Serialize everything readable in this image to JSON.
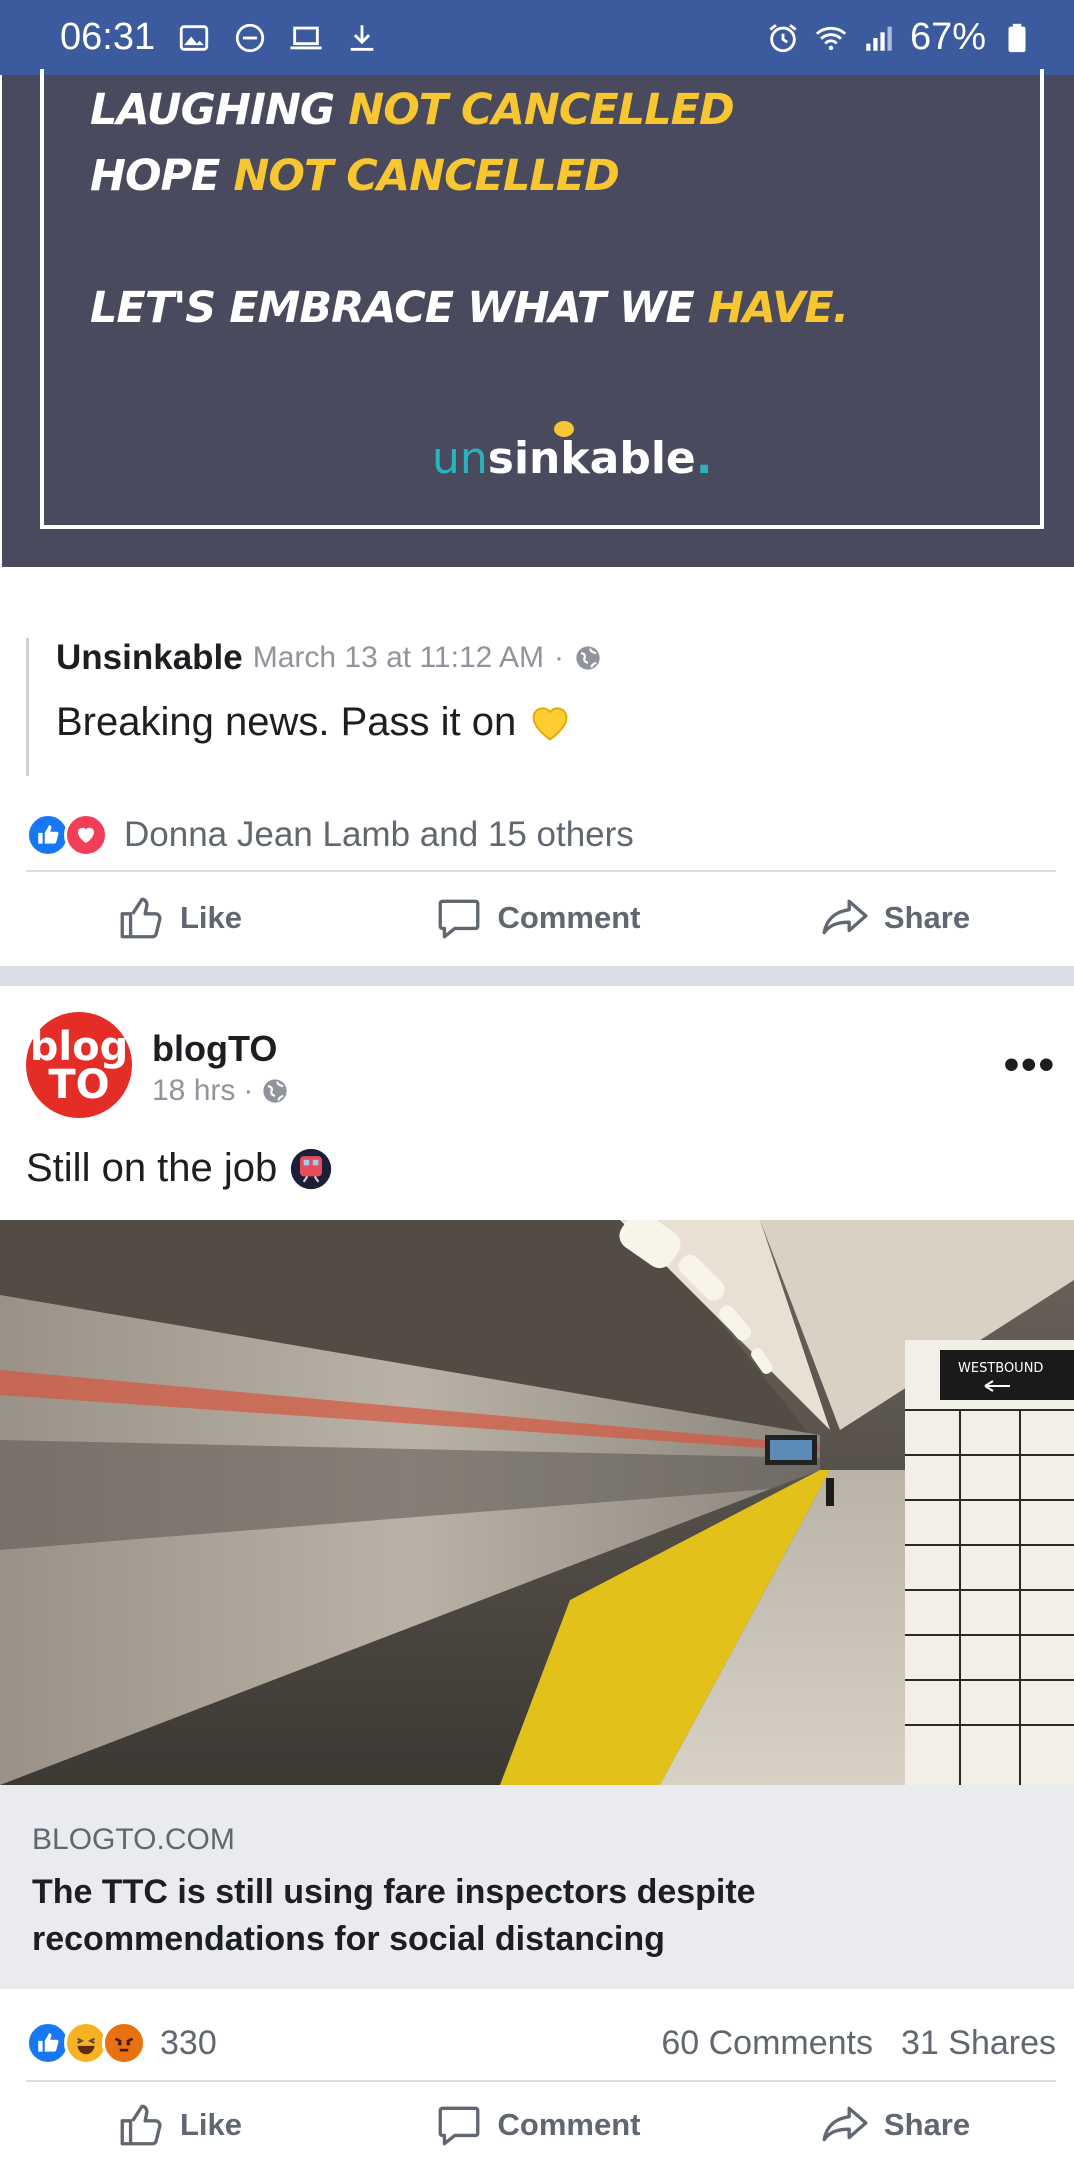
{
  "status_bar": {
    "time": "06:31",
    "battery": "67%",
    "left_icons": [
      "image-icon",
      "do-not-disturb-icon",
      "laptop-icon",
      "download-icon"
    ],
    "right_icons": [
      "alarm-icon",
      "wifi-icon",
      "signal-icon",
      "battery-icon"
    ]
  },
  "banner": {
    "line1_white": "Laughing ",
    "line1_yellow": "not cancelled",
    "line2_white": "Hope ",
    "line2_yellow": "not cancelled",
    "line3_white": "Let's embrace what we ",
    "line3_yellow": "have.",
    "logo_part1": "un",
    "logo_part2": "sinkable",
    "logo_dot": ".",
    "colors": {
      "background": "#4a4a5e",
      "accent": "#f8c630",
      "logo_teal": "#28b3bd"
    }
  },
  "shared_post": {
    "author": "Unsinkable",
    "timestamp": "March 13 at 11:12 AM",
    "separator": "·",
    "privacy_icon": "globe-icon",
    "text": "Breaking news. Pass it on",
    "emoji": "yellow-heart"
  },
  "first_post_reactions": {
    "icons": [
      "like",
      "love"
    ],
    "names": "Donna Jean Lamb and 15 others"
  },
  "actions": {
    "like": "Like",
    "comment": "Comment",
    "share": "Share"
  },
  "blogto_post": {
    "avatar_line1": "blog",
    "avatar_line2": "TO",
    "page_name": "blogTO",
    "time": "18 hrs",
    "separator": "·",
    "privacy_icon": "globe-icon",
    "more_label": "•••",
    "text": "Still on the job",
    "emoji": "subway-train",
    "photo_sign": "WESTBOUND",
    "link_domain": "BLOGTO.COM",
    "link_title": "The TTC is still using fare inspectors despite recommendations for social distancing",
    "reaction_icons": [
      "like",
      "haha",
      "angry"
    ],
    "reaction_count": "330",
    "comments": "60 Comments",
    "shares": "31 Shares"
  }
}
